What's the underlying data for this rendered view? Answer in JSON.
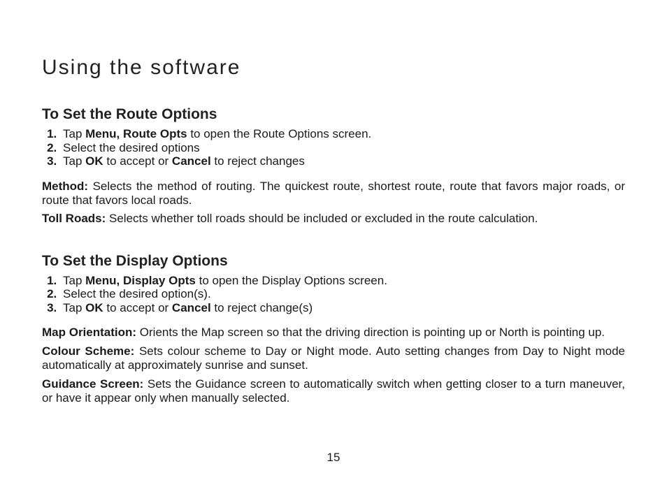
{
  "chapterTitle": "Using the software",
  "sections": {
    "routeOptions": {
      "title": "To Set the Route Options",
      "steps": {
        "s1a": "Tap ",
        "s1b": "Menu, Route Opts",
        "s1c": " to open the Route Options screen.",
        "s2": "Select the desired options",
        "s3a": "Tap ",
        "s3b": "OK",
        "s3c": " to accept or ",
        "s3d": "Cancel",
        "s3e": " to reject changes"
      },
      "defs": {
        "method": {
          "lead": "Method: ",
          "text": "Selects the method of routing. The quickest route, shortest route, route that favors major roads, or route that favors local roads."
        },
        "tollRoads": {
          "lead": "Toll Roads: ",
          "text": "Selects whether toll roads should be included or excluded in the route calculation."
        }
      }
    },
    "displayOptions": {
      "title": "To Set the Display Options",
      "steps": {
        "s1a": "Tap ",
        "s1b": "Menu, Display Opts",
        "s1c": " to open the Display Options screen.",
        "s2": "Select the desired option(s).",
        "s3a": "Tap ",
        "s3b": "OK",
        "s3c": " to accept or ",
        "s3d": "Cancel",
        "s3e": " to reject change(s)"
      },
      "defs": {
        "mapOrientation": {
          "lead": "Map Orientation: ",
          "text": "Orients the Map screen so that the driving direction is pointing up or North is pointing up."
        },
        "colourScheme": {
          "lead": "Colour Scheme: ",
          "text": "Sets colour scheme to Day or Night mode.  Auto setting changes from Day to Night mode automatically at approximately sunrise and sunset."
        },
        "guidanceScreen": {
          "lead": "Guidance Screen: ",
          "text": "Sets the Guidance screen to automatically switch when getting closer to a turn maneuver, or have it appear only when manually selected."
        }
      }
    }
  },
  "pageNumber": "15"
}
